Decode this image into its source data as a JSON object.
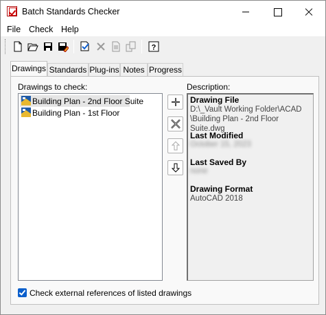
{
  "window": {
    "title": "Batch Standards Checker"
  },
  "menu": [
    "File",
    "Check",
    "Help"
  ],
  "toolbar": {
    "buttons": [
      {
        "name": "new-icon"
      },
      {
        "name": "open-icon"
      },
      {
        "name": "save-icon"
      },
      {
        "name": "save-as-icon"
      },
      {
        "name": "add-drawing-icon"
      },
      {
        "name": "remove-drawing-icon"
      },
      {
        "name": "standards-file-icon"
      },
      {
        "name": "check-standards-icon"
      },
      {
        "name": "help-icon"
      }
    ]
  },
  "tabs": [
    "Drawings",
    "Standards",
    "Plug-ins",
    "Notes",
    "Progress"
  ],
  "active_tab": "Drawings",
  "drawings": {
    "label": "Drawings to check:",
    "items": [
      {
        "name": "Building Plan - 2nd Floor Suite",
        "selected": true
      },
      {
        "name": "Building Plan - 1st Floor",
        "selected": false
      }
    ]
  },
  "description": {
    "label": "Description:",
    "file_heading": "Drawing File",
    "file_path_1": "D:\\_Vault Working Folder\\ACAD",
    "file_path_2": "\\Building Plan - 2nd Floor Suite.dwg",
    "modified_heading": "Last Modified",
    "modified_value": "October 15, 2023",
    "saved_by_heading": "Last Saved By",
    "saved_by_value": "none",
    "format_heading": "Drawing Format",
    "format_value": "AutoCAD 2018"
  },
  "xref_check": {
    "label": "Check external references of listed drawings",
    "checked": true
  },
  "colors": {
    "accent": "#0b5fcc",
    "selection": "#e5e5e5"
  }
}
